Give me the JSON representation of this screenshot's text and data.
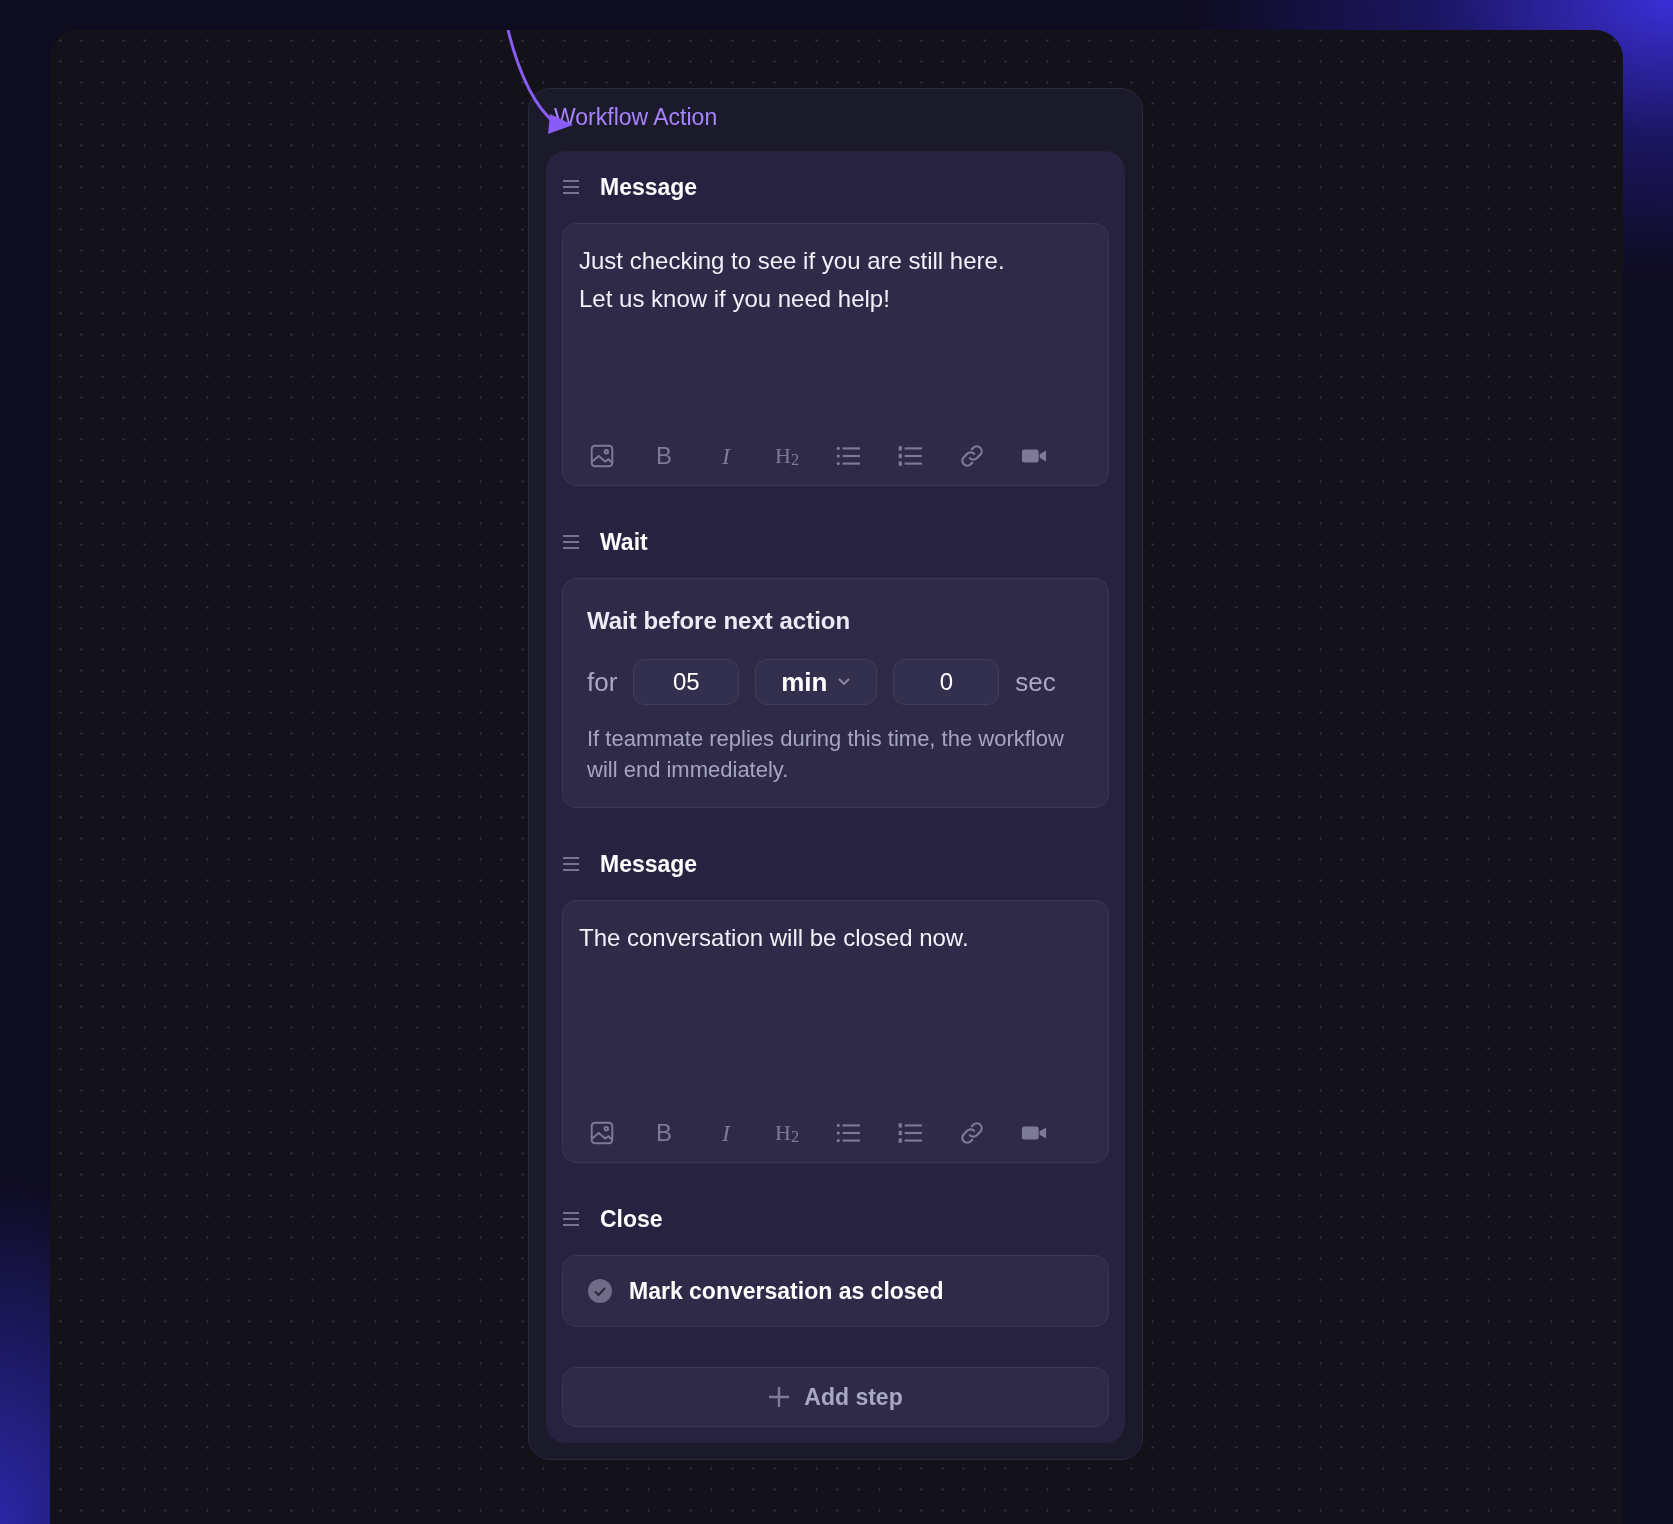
{
  "title": "Workflow Action",
  "steps": [
    {
      "kind": "message",
      "heading": "Message",
      "text": [
        "Just checking to see if you are still here.",
        "Let us know if you need help!"
      ],
      "toolbar": [
        {
          "kind": "image"
        },
        {
          "kind": "bold",
          "label": "B"
        },
        {
          "kind": "italic",
          "label": "I"
        },
        {
          "kind": "heading",
          "label": "H$_{2}$"
        },
        {
          "kind": "bullets"
        },
        {
          "kind": "numbers"
        },
        {
          "kind": "link"
        },
        {
          "kind": "video"
        }
      ]
    },
    {
      "kind": "wait",
      "heading": "Wait",
      "title": "Wait before next action",
      "prefix": "for",
      "amount": "05",
      "unit": "min",
      "seconds": "0",
      "suffix": "sec",
      "hint": "If teammate replies during this time, the workflow will end immediately."
    },
    {
      "kind": "message",
      "heading": "Message",
      "text": [
        "The conversation will be closed now."
      ],
      "toolbar": [
        {
          "kind": "image"
        },
        {
          "kind": "bold",
          "label": "B"
        },
        {
          "kind": "italic",
          "label": "I"
        },
        {
          "kind": "heading",
          "label": "H$_{2}$"
        },
        {
          "kind": "bullets"
        },
        {
          "kind": "numbers"
        },
        {
          "kind": "link"
        },
        {
          "kind": "video"
        }
      ]
    },
    {
      "kind": "close",
      "heading": "Close",
      "label": "Mark conversation as closed",
      "checked": true
    }
  ],
  "add_button": "Add step"
}
